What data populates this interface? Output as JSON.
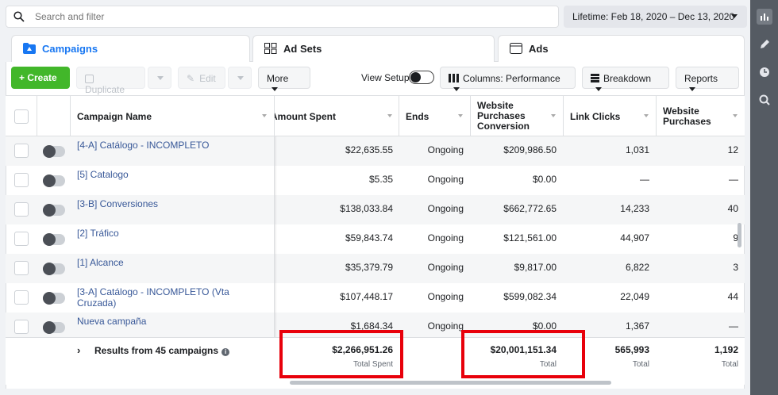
{
  "search": {
    "placeholder": "Search and filter"
  },
  "date_range": {
    "label": "Lifetime: Feb 18, 2020 – Dec 13, 2020"
  },
  "tabs": [
    {
      "label": "Campaigns",
      "icon": "campaigns-folder-icon"
    },
    {
      "label": "Ad Sets",
      "icon": "ad-sets-grid-icon"
    },
    {
      "label": "Ads",
      "icon": "ads-window-icon"
    }
  ],
  "toolbar": {
    "create_label": "+ Create",
    "duplicate_label": "Duplicate",
    "edit_label": "Edit",
    "more_label": "More",
    "view_setup_label": "View Setup",
    "columns_label": "Columns: Performance",
    "breakdown_label": "Breakdown",
    "reports_label": "Reports"
  },
  "columns": {
    "campaign_name": "Campaign Name",
    "amount_spent": "Amount Spent",
    "ends": "Ends",
    "website_purchases_conversion": "Website Purchases Conversion",
    "link_clicks": "Link Clicks",
    "website_purchases": "Website Purchases"
  },
  "rows": [
    {
      "name": "[4-A] Catálogo - INCOMPLETO",
      "amount_spent": "$22,635.55",
      "ends": "Ongoing",
      "conversion": "$209,986.50",
      "link_clicks": "1,031",
      "purchases": "12"
    },
    {
      "name": "[5] Catalogo",
      "amount_spent": "$5.35",
      "ends": "Ongoing",
      "conversion": "$0.00",
      "link_clicks": "—",
      "purchases": "—"
    },
    {
      "name": "[3-B] Conversiones",
      "amount_spent": "$138,033.84",
      "ends": "Ongoing",
      "conversion": "$662,772.65",
      "link_clicks": "14,233",
      "purchases": "40"
    },
    {
      "name": "[2] Tráfico",
      "amount_spent": "$59,843.74",
      "ends": "Ongoing",
      "conversion": "$121,561.00",
      "link_clicks": "44,907",
      "purchases": "9"
    },
    {
      "name": "[1] Alcance",
      "amount_spent": "$35,379.79",
      "ends": "Ongoing",
      "conversion": "$9,817.00",
      "link_clicks": "6,822",
      "purchases": "3"
    },
    {
      "name": "[3-A] Catálogo - INCOMPLETO (Vta Cruzada)",
      "amount_spent": "$107,448.17",
      "ends": "Ongoing",
      "conversion": "$599,082.34",
      "link_clicks": "22,049",
      "purchases": "44"
    },
    {
      "name": "Nueva campaña",
      "amount_spent": "$1,684.34",
      "ends": "Ongoing",
      "conversion": "$0.00",
      "link_clicks": "1,367",
      "purchases": "—"
    }
  ],
  "footer": {
    "results_label": "Results from 45 campaigns",
    "amount_spent_total": "$2,266,951.26",
    "amount_spent_caption": "Total Spent",
    "conversion_total": "$20,001,151.34",
    "conversion_caption": "Total",
    "link_clicks_total": "565,993",
    "link_clicks_caption": "Total",
    "purchases_total": "1,192",
    "purchases_caption": "Total"
  },
  "rail_icons": [
    "bar-chart-icon",
    "pencil-icon",
    "clock-icon",
    "search-zoom-icon"
  ],
  "colors": {
    "accent": "#1877f2",
    "create": "#42b72a",
    "highlight": "#e8000b",
    "link": "#385898"
  }
}
